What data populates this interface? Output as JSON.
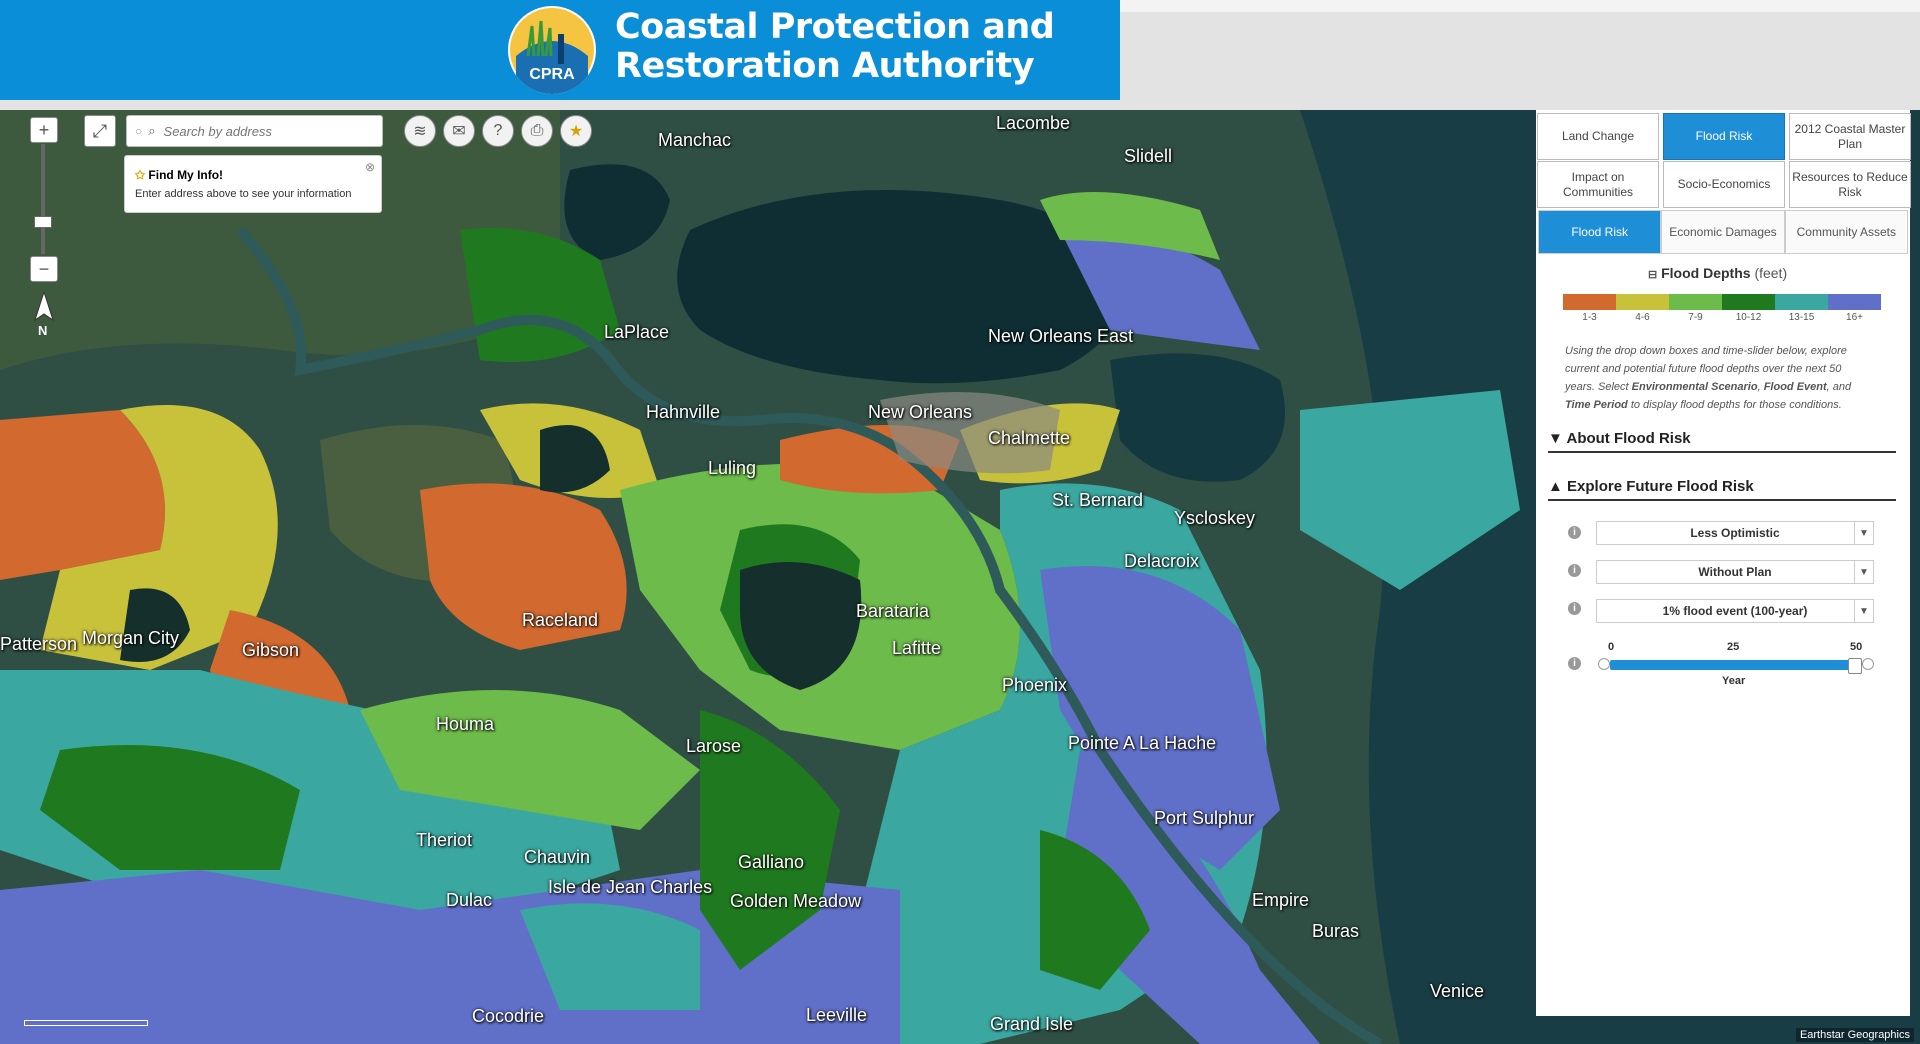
{
  "header": {
    "logo_text": "CPRA",
    "title_line1": "Coastal Protection and",
    "title_line2": "Restoration Authority"
  },
  "map_controls": {
    "zoom_in": "+",
    "zoom_out": "−",
    "north_label": "N",
    "search_placeholder": "Search by address",
    "find_my_info_title": "Find My Info!",
    "find_my_info_text": "Enter address above to see your information"
  },
  "places": [
    "Manchac",
    "Lacombe",
    "Slidell",
    "LaPlace",
    "New Orleans East",
    "Hahnville",
    "New Orleans",
    "Chalmette",
    "Luling",
    "St. Bernard",
    "Yscloskey",
    "Delacroix",
    "Barataria",
    "Raceland",
    "Lafitte",
    "Patterson",
    "Morgan City",
    "Gibson",
    "Phoenix",
    "Houma",
    "Larose",
    "Pointe A La Hache",
    "Port Sulphur",
    "Theriot",
    "Chauvin",
    "Galliano",
    "Isle de Jean Charles",
    "Dulac",
    "Golden Meadow",
    "Empire",
    "Buras",
    "Venice",
    "Cocodrie",
    "Leeville",
    "Grand Isle"
  ],
  "attribution": "Earthstar Geographics",
  "panel": {
    "main_tabs": [
      {
        "label": "Land Change",
        "active": false
      },
      {
        "label": "Flood Risk",
        "active": true
      },
      {
        "label": "2012 Coastal Master Plan",
        "active": false
      },
      {
        "label": "Impact on Communities",
        "active": false
      },
      {
        "label": "Socio-Economics",
        "active": false
      },
      {
        "label": "Resources to Reduce Risk",
        "active": false
      }
    ],
    "sub_tabs": [
      {
        "label": "Flood Risk",
        "active": true
      },
      {
        "label": "Economic Damages",
        "active": false
      },
      {
        "label": "Community Assets",
        "active": false
      }
    ],
    "legend": {
      "title": "Flood Depths",
      "unit": "(feet)",
      "bins": [
        {
          "label": "1-3",
          "color": "#d2692f"
        },
        {
          "label": "4-6",
          "color": "#c8c23a"
        },
        {
          "label": "7-9",
          "color": "#6dbb4a"
        },
        {
          "label": "10-12",
          "color": "#1f7a1f"
        },
        {
          "label": "13-15",
          "color": "#3aa8a0"
        },
        {
          "label": "16+",
          "color": "#6070c8"
        }
      ]
    },
    "description": {
      "part1": "Using the drop down boxes and time-slider below, explore current and potential future flood depths over the next 50 years. Select ",
      "bold1": "Environmental Scenario",
      "part2": ", ",
      "bold2": "Flood Event",
      "part3": ", and ",
      "bold3": "Time Period",
      "part4": " to display flood depths for those conditions."
    },
    "section_about": "About Flood Risk",
    "section_explore": "Explore Future Flood Risk",
    "selects": [
      "Less Optimistic",
      "Without Plan",
      "1% flood event (100-year)"
    ],
    "slider": {
      "min_label": "0",
      "mid_label": "25",
      "max_label": "50",
      "axis_label": "Year",
      "value": 50,
      "max": 50
    }
  }
}
